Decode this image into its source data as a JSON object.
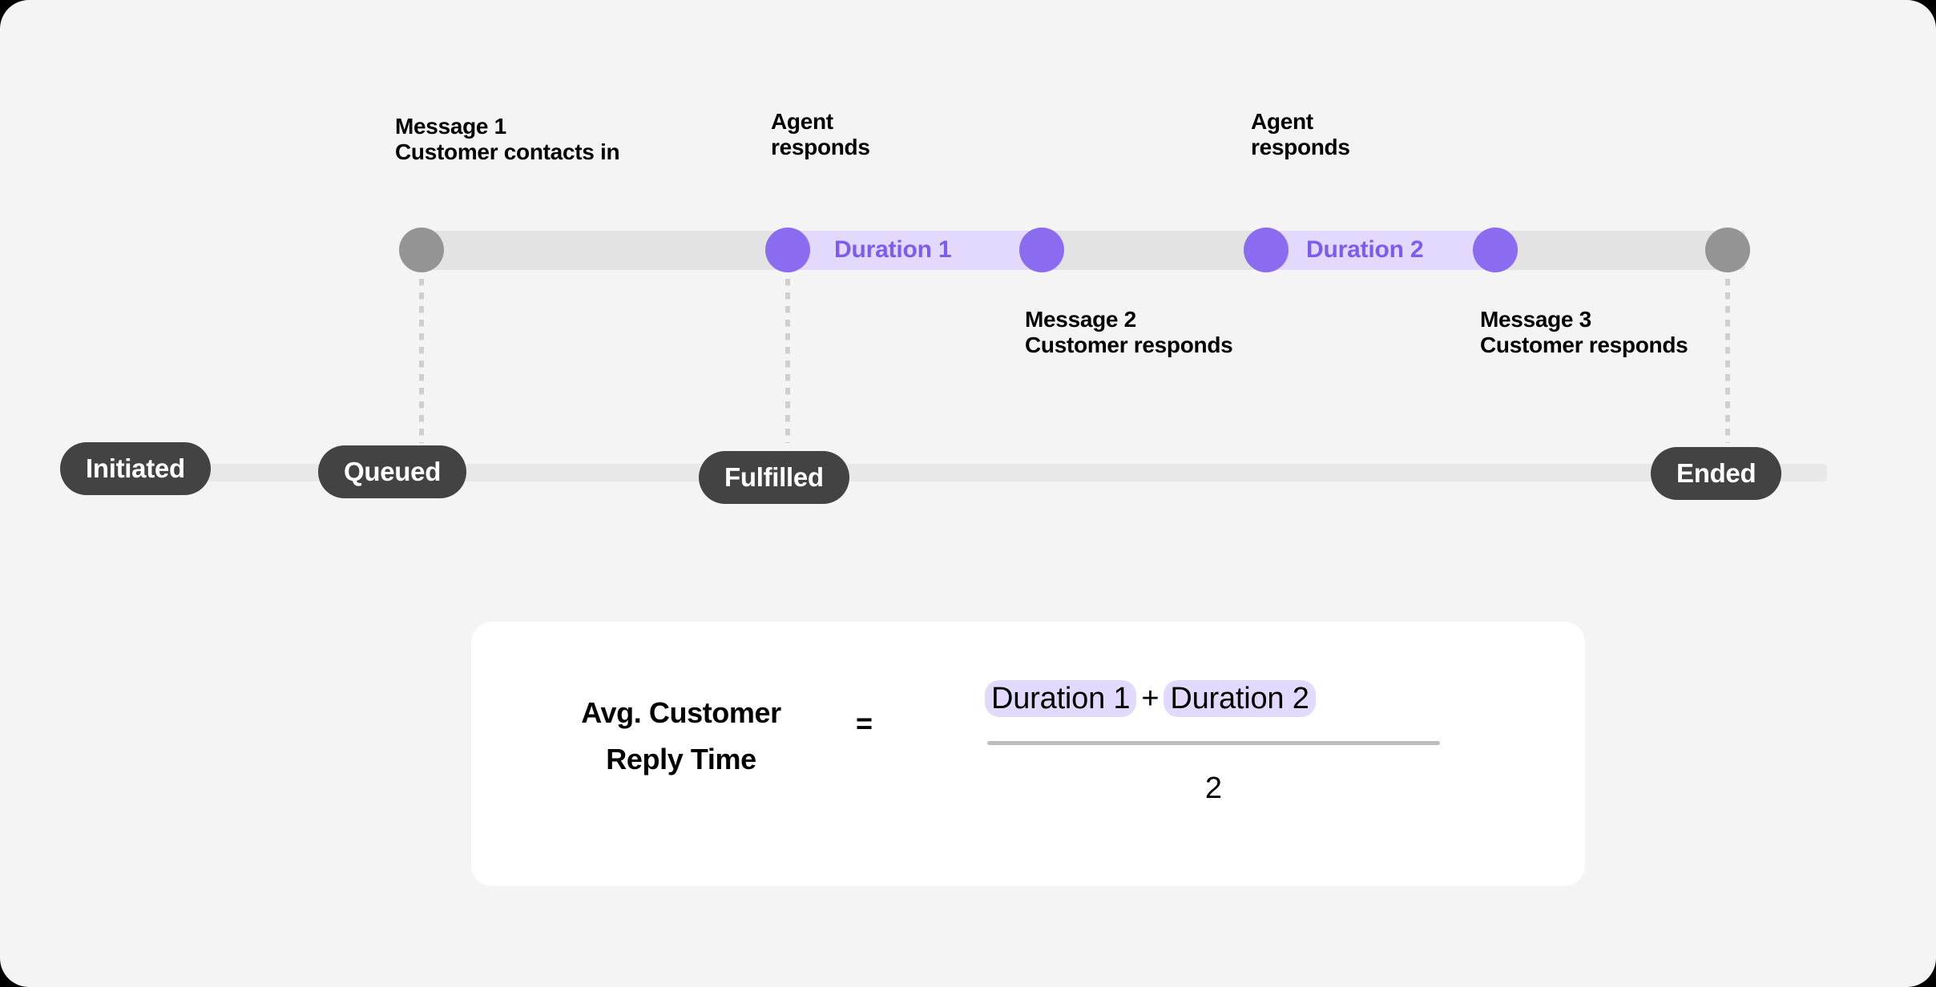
{
  "diagram": {
    "title": "Average Customer Reply Time timeline",
    "colors": {
      "background": "#f4f4f4",
      "timeline_track": "#e3e3e3",
      "duration_band": "#e3d9fd",
      "purple_dot": "#8b6cf0",
      "purple_text": "#7c5cf0",
      "gray_dot": "#949494",
      "pill_background": "#434343",
      "pill_text": "#ffffff",
      "card_background": "#ffffff",
      "rail": "#e8e8e8",
      "connector": "#cfcfcf"
    }
  },
  "timeline": {
    "markers": [
      {
        "id": "start",
        "type": "gray",
        "label": ""
      },
      {
        "id": "agent1",
        "type": "purple",
        "label": ""
      },
      {
        "id": "msg2",
        "type": "purple",
        "label": ""
      },
      {
        "id": "agent2",
        "type": "purple",
        "label": ""
      },
      {
        "id": "msg3",
        "type": "purple",
        "label": ""
      },
      {
        "id": "end",
        "type": "gray",
        "label": ""
      }
    ],
    "durations": [
      {
        "id": "duration-1",
        "label": "Duration 1"
      },
      {
        "id": "duration-2",
        "label": "Duration 2"
      }
    ],
    "callouts": {
      "message_1": "Message 1\nCustomer contacts in",
      "agent_responds_1": "Agent\nresponds",
      "agent_responds_2": "Agent\nresponds",
      "message_2": "Message 2\nCustomer responds",
      "message_3": "Message 3\nCustomer responds"
    }
  },
  "status": {
    "pills": [
      {
        "id": "initiated",
        "label": "Initiated"
      },
      {
        "id": "queued",
        "label": "Queued"
      },
      {
        "id": "fulfilled",
        "label": "Fulfilled"
      },
      {
        "id": "ended",
        "label": "Ended"
      }
    ]
  },
  "formula": {
    "lhs": "Avg. Customer\nReply Time",
    "equals": "=",
    "numerator_term_1": "Duration 1",
    "numerator_operator": "+",
    "numerator_term_2": "Duration 2",
    "denominator": "2"
  }
}
